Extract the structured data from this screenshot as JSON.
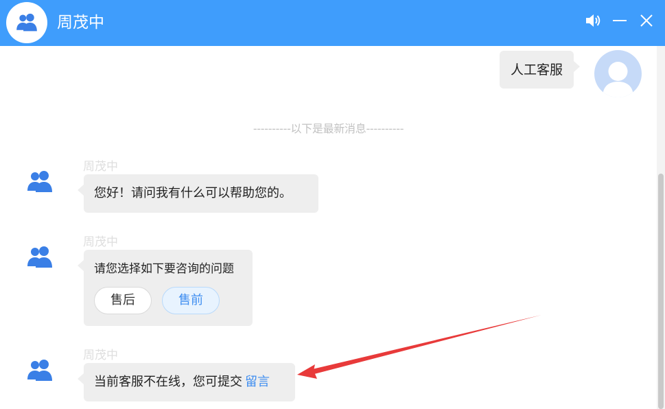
{
  "header": {
    "title": "周茂中",
    "icons": [
      "group-avatar-icon",
      "speaker-icon",
      "minimize-icon",
      "close-icon"
    ],
    "color": "#3f9dfc"
  },
  "messages": {
    "user_message": "人工客服",
    "divider": "----------以下是最新消息----------",
    "agent_name": "周茂中",
    "greeting": "您好！请问我有什么可以帮助您的。",
    "choose_prompt": "请您选择如下要咨询的问题",
    "option_after_sales": "售后",
    "option_pre_sales": "售前",
    "offline_text": "当前客服不在线，您可提交",
    "leave_message_link": "留言"
  },
  "colors": {
    "accent": "#3f9dfc",
    "link": "#3f8ef0",
    "bubble": "#eeeeee",
    "annotation_arrow": "#e83a3a"
  }
}
